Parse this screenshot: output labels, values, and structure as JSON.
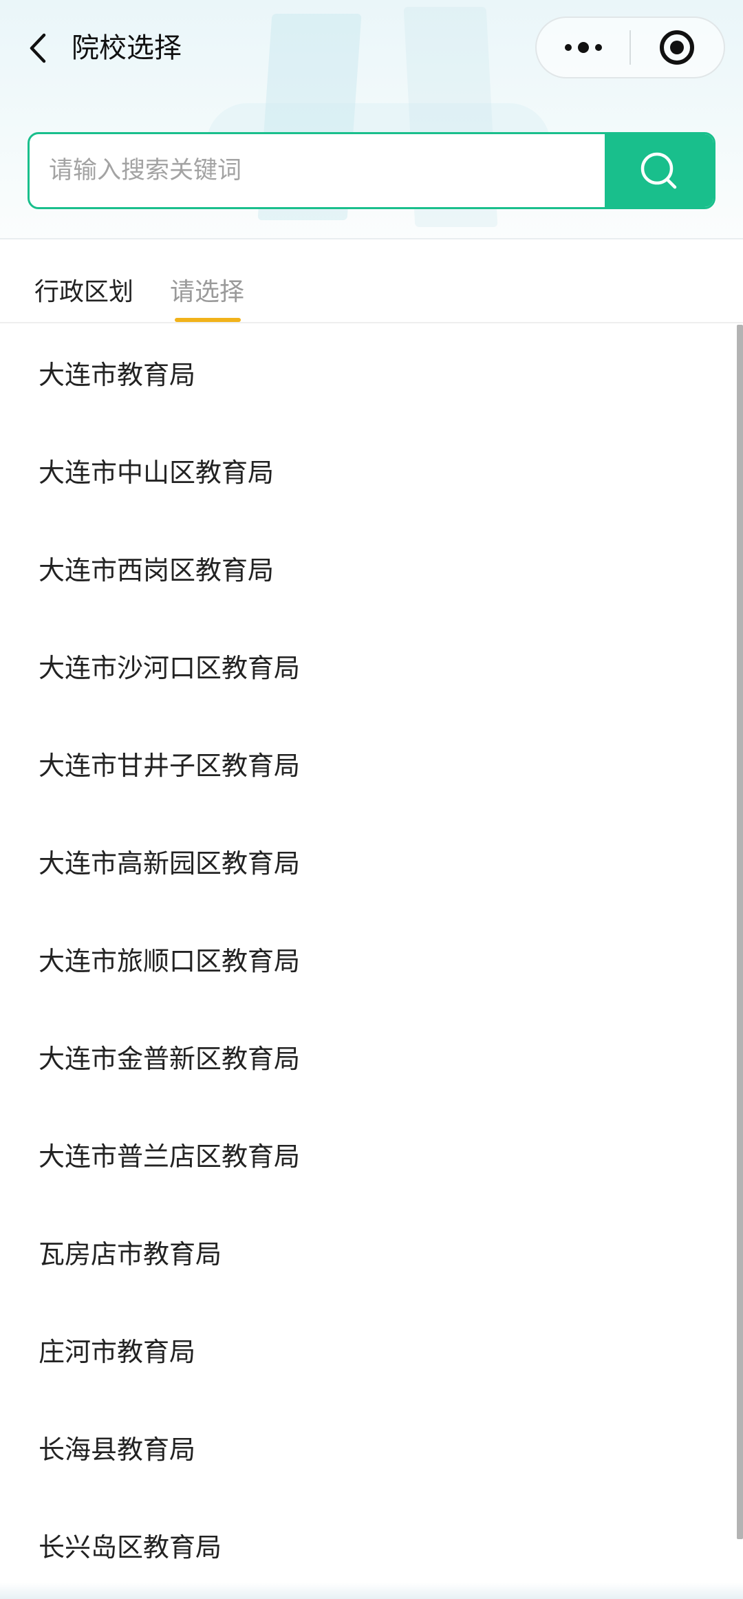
{
  "nav": {
    "title": "院校选择"
  },
  "search": {
    "placeholder": "请输入搜索关键词",
    "value": ""
  },
  "tabs": {
    "region_label": "行政区划",
    "select_label": "请选择"
  },
  "colors": {
    "accent": "#19bf8c",
    "tab_indicator": "#f1b21a"
  },
  "list": {
    "items": [
      "大连市教育局",
      "大连市中山区教育局",
      "大连市西岗区教育局",
      "大连市沙河口区教育局",
      "大连市甘井子区教育局",
      "大连市高新园区教育局",
      "大连市旅顺口区教育局",
      "大连市金普新区教育局",
      "大连市普兰店区教育局",
      "瓦房店市教育局",
      "庄河市教育局",
      "长海县教育局",
      "长兴岛区教育局"
    ]
  }
}
